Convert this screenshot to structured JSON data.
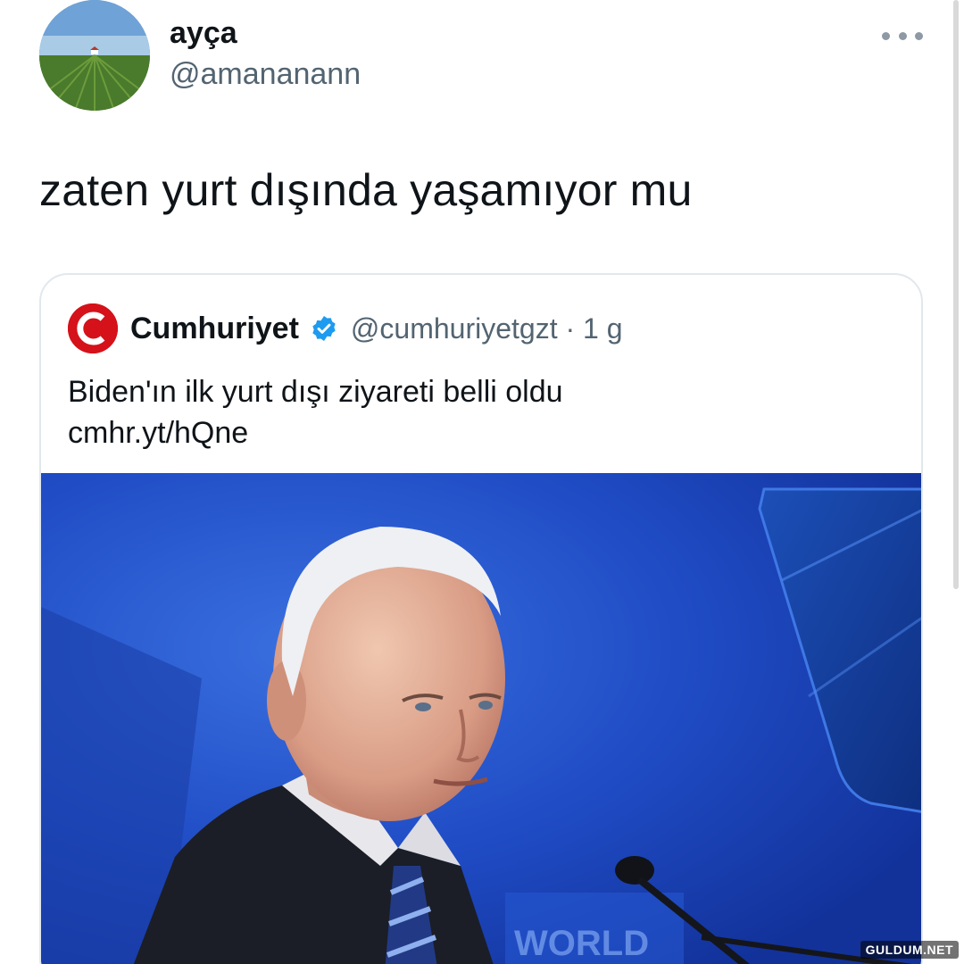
{
  "author": {
    "display_name": "ayça",
    "handle": "@amananann",
    "avatar": "field-landscape-avatar"
  },
  "tweet": {
    "text": "zaten yurt dışında yaşamıyor mu"
  },
  "quoted_tweet": {
    "name": "Cumhuriyet",
    "handle_time": "@cumhuriyetgzt · 1 g",
    "verified_icon": "verified-badge-icon",
    "text_line_1": "Biden'ın ilk yurt dışı ziyareti belli oldu",
    "text_line_2": "cmhr.yt/hQne",
    "image_overlay_text": "WORLD"
  },
  "watermark": "GULDUM.NET",
  "colors": {
    "text": "#0f1419",
    "secondary": "#536471",
    "verified": "#1d9bf0",
    "cumhuriyet_red": "#d5111a",
    "photo_background": "#1d4ac2"
  }
}
